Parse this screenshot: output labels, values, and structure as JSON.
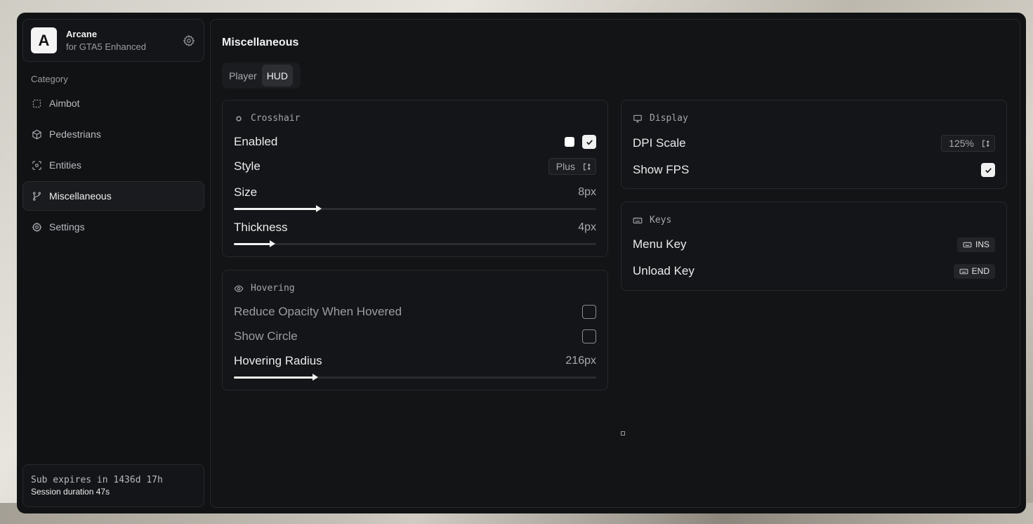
{
  "brand": {
    "logo_letter": "A",
    "name": "Arcane",
    "subtitle": "for GTA5 Enhanced"
  },
  "sidebar": {
    "category_label": "Category",
    "items": [
      {
        "label": "Aimbot",
        "icon": "crosshair-frame-icon",
        "active": false
      },
      {
        "label": "Pedestrians",
        "icon": "cube-icon",
        "active": false
      },
      {
        "label": "Entities",
        "icon": "scan-icon",
        "active": false
      },
      {
        "label": "Miscellaneous",
        "icon": "branch-icon",
        "active": true
      },
      {
        "label": "Settings",
        "icon": "gear-icon",
        "active": false
      }
    ]
  },
  "subscription": {
    "expires": "Sub expires in 1436d 17h",
    "session": "Session duration 47s"
  },
  "main": {
    "title": "Miscellaneous",
    "tabs": [
      {
        "label": "Player",
        "active": false
      },
      {
        "label": "HUD",
        "active": true
      }
    ]
  },
  "crosshair": {
    "title": "Crosshair",
    "enabled_label": "Enabled",
    "enabled_color": "#ffffff",
    "enabled": true,
    "style_label": "Style",
    "style_value": "Plus",
    "size_label": "Size",
    "size_value": "8px",
    "size_fraction": 0.235,
    "thickness_label": "Thickness",
    "thickness_value": "4px",
    "thickness_fraction": 0.106
  },
  "hovering": {
    "title": "Hovering",
    "reduce_opacity_label": "Reduce Opacity When Hovered",
    "reduce_opacity": false,
    "show_circle_label": "Show Circle",
    "show_circle": false,
    "radius_label": "Hovering Radius",
    "radius_value": "216px",
    "radius_fraction": 0.225
  },
  "display": {
    "title": "Display",
    "dpi_label": "DPI Scale",
    "dpi_value": "125%",
    "fps_label": "Show FPS",
    "fps": true
  },
  "keys": {
    "title": "Keys",
    "menu_label": "Menu Key",
    "menu_key": "INS",
    "unload_label": "Unload Key",
    "unload_key": "END"
  }
}
